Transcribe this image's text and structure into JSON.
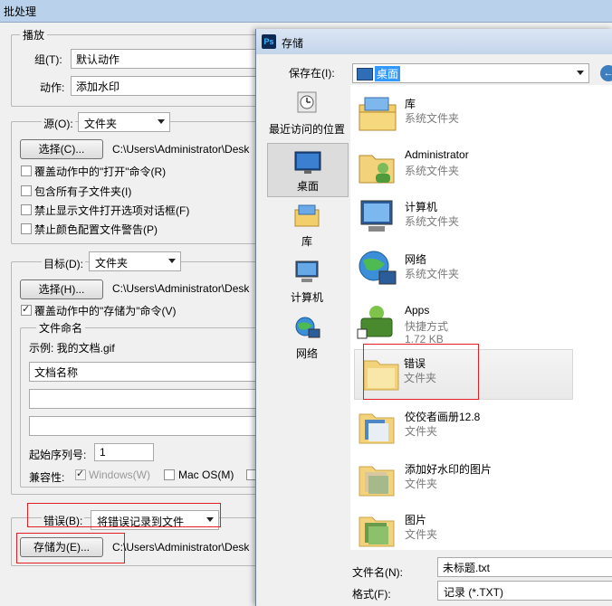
{
  "batch_dialog": {
    "title": "批处理",
    "play": {
      "legend": "播放",
      "group_label": "组(T):",
      "group_value": "默认动作",
      "action_label": "动作:",
      "action_value": "添加水印"
    },
    "source": {
      "label": "源(O):",
      "value": "文件夹",
      "choose_button": "选择(C)...",
      "path": "C:\\Users\\Administrator\\Desk",
      "options": [
        {
          "label": "覆盖动作中的\"打开\"命令(R)",
          "checked": false
        },
        {
          "label": "包含所有子文件夹(I)",
          "checked": false
        },
        {
          "label": "禁止显示文件打开选项对话框(F)",
          "checked": false
        },
        {
          "label": "禁止颜色配置文件警告(P)",
          "checked": false
        }
      ]
    },
    "destination": {
      "label": "目标(D):",
      "value": "文件夹",
      "choose_button": "选择(H)...",
      "path": "C:\\Users\\Administrator\\Desk",
      "override_save": {
        "label": "覆盖动作中的\"存储为\"命令(V)",
        "checked": true
      },
      "file_naming": {
        "legend": "文件命名",
        "example": "示例: 我的文档.gif",
        "field1": "文档名称",
        "field2": "",
        "field3": "",
        "serial_label": "起始序列号:",
        "serial_value": "1",
        "compat_label": "兼容性:",
        "compat": [
          {
            "label": "Windows(W)",
            "checked": true,
            "disabled": true
          },
          {
            "label": "Mac OS(M)",
            "checked": false,
            "disabled": false
          }
        ]
      }
    },
    "errors": {
      "label": "错误(B):",
      "value": "将错误记录到文件",
      "save_as_button": "存储为(E)...",
      "path": "C:\\Users\\Administrator\\Desk"
    }
  },
  "save_dialog": {
    "app_icon": "Ps",
    "title": "存储",
    "save_in_label": "保存在(I):",
    "save_in_value": "桌面",
    "places": [
      {
        "label": "最近访问的位置",
        "icon": "recent-places-icon"
      },
      {
        "label": "桌面",
        "icon": "desktop-icon",
        "selected": true
      },
      {
        "label": "库",
        "icon": "library-icon"
      },
      {
        "label": "计算机",
        "icon": "computer-icon"
      },
      {
        "label": "网络",
        "icon": "network-icon"
      }
    ],
    "items": [
      {
        "name": "库",
        "type": "系统文件夹",
        "size": "",
        "icon": "library-icon"
      },
      {
        "name": "Administrator",
        "type": "系统文件夹",
        "size": "",
        "icon": "user-folder-icon"
      },
      {
        "name": "计算机",
        "type": "系统文件夹",
        "size": "",
        "icon": "computer-icon"
      },
      {
        "name": "网络",
        "type": "系统文件夹",
        "size": "",
        "icon": "network-icon"
      },
      {
        "name": "Apps",
        "type": "快捷方式",
        "size": "1.72 KB",
        "icon": "apps-shortcut-icon"
      },
      {
        "name": "错误",
        "type": "文件夹",
        "size": "",
        "icon": "folder-icon",
        "highlighted": true
      },
      {
        "name": "佼佼者画册12.8",
        "type": "文件夹",
        "size": "",
        "icon": "folder-icon"
      },
      {
        "name": "添加好水印的图片",
        "type": "文件夹",
        "size": "",
        "icon": "folder-icon"
      },
      {
        "name": "图片",
        "type": "文件夹",
        "size": "",
        "icon": "folder-icon"
      }
    ],
    "filename_label": "文件名(N):",
    "filename_value": "未标题.txt",
    "format_label": "格式(F):",
    "format_value": "记录 (*.TXT)"
  },
  "colors": {
    "highlight_border": "#e02020",
    "selection": "#cce4f7",
    "title_bar": "#c4d5ea"
  }
}
